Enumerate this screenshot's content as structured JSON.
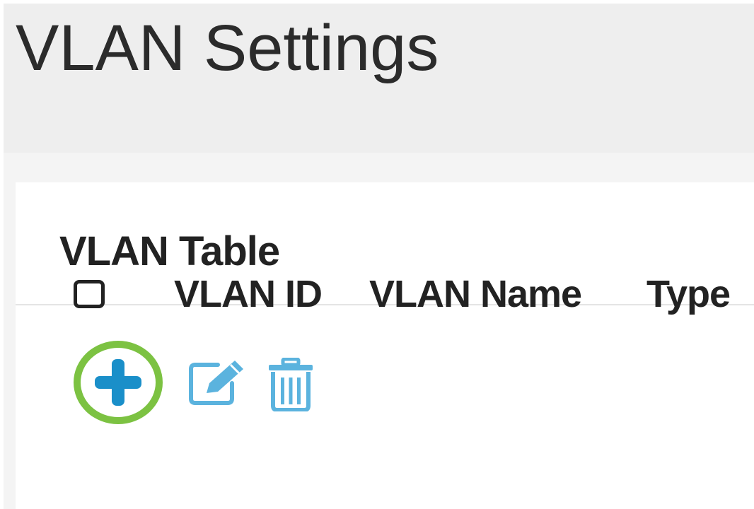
{
  "header": {
    "title": "VLAN Settings"
  },
  "panel": {
    "title": "VLAN Table"
  },
  "toolbar": {
    "add_icon": "plus-icon",
    "edit_icon": "edit-icon",
    "delete_icon": "trash-icon"
  },
  "table": {
    "columns": [
      "VLAN ID",
      "VLAN Name",
      "Type"
    ]
  },
  "colors": {
    "accent": "#1a8fc9",
    "accent_light": "#5bb3de",
    "highlight": "#7cc242",
    "header_bg": "#eeeeee",
    "text": "#222222"
  }
}
